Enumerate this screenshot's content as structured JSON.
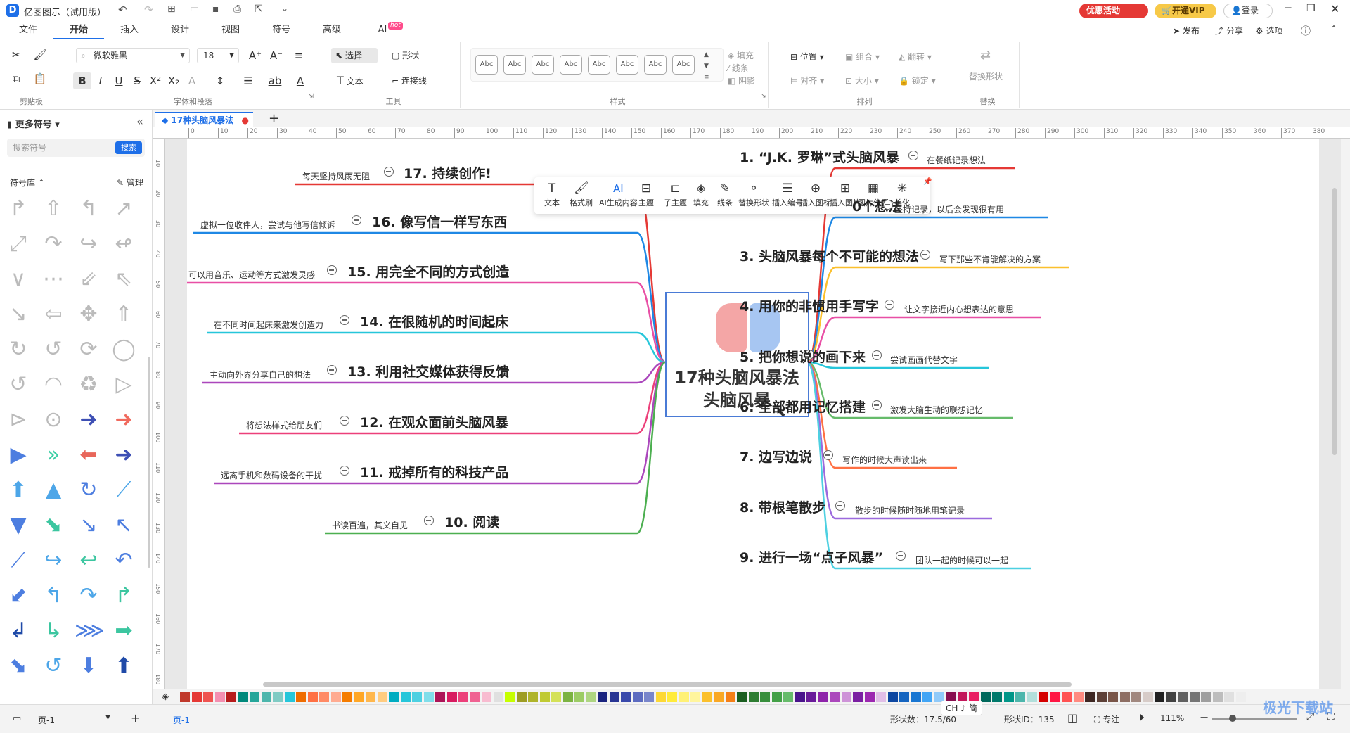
{
  "app": {
    "title": "亿图图示（试用版）"
  },
  "titlebar": {
    "promo": "优惠活动",
    "vip": "开通VIP",
    "login": "登录"
  },
  "menu": {
    "tabs": [
      "文件",
      "开始",
      "插入",
      "设计",
      "视图",
      "符号",
      "高级",
      "AI"
    ],
    "active": "开始",
    "ai_badge": "hot",
    "right": {
      "publish": "发布",
      "share": "分享",
      "options": "选项"
    }
  },
  "ribbon": {
    "font_name": "微软雅黑",
    "font_size": "18",
    "groups": {
      "clipboard": "剪贴板",
      "font": "字体和段落",
      "tools": "工具",
      "style": "样式",
      "arrange": "排列",
      "replace": "替换"
    },
    "tools": {
      "select": "选择",
      "shape": "形状",
      "text": "文本",
      "connector": "连接线"
    },
    "style_sample": "Abc",
    "style_count": 8,
    "fill": {
      "fill": "填充",
      "line": "线条",
      "shadow": "阴影"
    },
    "arrange": {
      "position": "位置",
      "group": "组合",
      "flip": "翻转",
      "align": "对齐",
      "size": "大小",
      "lock": "锁定"
    },
    "replace_shape": "替换形状"
  },
  "sidebar": {
    "title": "更多符号",
    "search_placeholder": "搜索符号",
    "search_btn": "搜索",
    "library": "符号库",
    "manage": "管理"
  },
  "doc_tab": {
    "name": "17种头脑风暴法"
  },
  "ruler": {
    "h_ticks": [
      "0",
      "10",
      "20",
      "30",
      "40",
      "50",
      "60",
      "70",
      "80",
      "90",
      "100",
      "110",
      "120",
      "130",
      "140",
      "150",
      "160",
      "170",
      "180",
      "190",
      "200",
      "210",
      "220",
      "230",
      "240",
      "250",
      "260",
      "270",
      "280",
      "290",
      "300",
      "310",
      "320",
      "330",
      "340",
      "350",
      "360",
      "370",
      "380"
    ],
    "v_ticks": [
      "10",
      "20",
      "30",
      "40",
      "50",
      "60",
      "70",
      "80",
      "90",
      "100",
      "110",
      "120",
      "130",
      "140",
      "150",
      "160",
      "170",
      "180"
    ]
  },
  "float_toolbar": [
    "文本",
    "格式刷",
    "AI生成内容",
    "主题",
    "子主题",
    "填充",
    "线条",
    "替换形状",
    "插入编号",
    "插入图标",
    "插入图片",
    "图片位置",
    "美化"
  ],
  "mindmap": {
    "center": {
      "line1": "17种头脑风暴法",
      "line2": "头脑风暴"
    },
    "right": [
      {
        "topic": "1. “J.K. 罗琳”式头脑风暴",
        "note": "在餐纸记录想法",
        "color": "#e53935"
      },
      {
        "topic": "0个想法",
        "note": "坚持记录，以后会发现很有用",
        "color": "#1e88e5"
      },
      {
        "topic": "3. 头脑风暴每个不可能的想法",
        "note": "写下那些不肯能解决的方案",
        "color": "#fbc02d"
      },
      {
        "topic": "4. 用你的非惯用手写字",
        "note": "让文字接近内心想表达的意思",
        "color": "#e84fa5"
      },
      {
        "topic": "5. 把你想说的画下来",
        "note": "尝试画画代替文字",
        "color": "#26c6da"
      },
      {
        "topic": "6. 全部都用记忆搭建",
        "note": "激发大脑生动的联想记忆",
        "color": "#66bb6a"
      },
      {
        "topic": "7. 边写边说",
        "note": "写作的时候大声读出来",
        "color": "#ff7043"
      },
      {
        "topic": "8. 带根笔散步",
        "note": "散步的时候随时随地用笔记录",
        "color": "#9c6ade"
      },
      {
        "topic": "9. 进行一场“点子风暴”",
        "note": "团队一起的时候可以一起",
        "color": "#4dd0e1"
      }
    ],
    "left": [
      {
        "topic": "17. 持续创作!",
        "note": "每天坚持风雨无阻",
        "color": "#e53935"
      },
      {
        "topic": "16. 像写信一样写东西",
        "note": "虚拟一位收件人，尝试与他写信倾诉",
        "color": "#1e88e5"
      },
      {
        "topic": "15. 用完全不同的方式创造",
        "note": "可以用音乐、运动等方式激发灵感",
        "color": "#e84fa5"
      },
      {
        "topic": "14. 在很随机的时间起床",
        "note": "在不同时间起床来激发创造力",
        "color": "#26c6da"
      },
      {
        "topic": "13. 利用社交媒体获得反馈",
        "note": "主动向外界分享自己的想法",
        "color": "#ab47bc"
      },
      {
        "topic": "12. 在观众面前头脑风暴",
        "note": "将想法样式给朋友们",
        "color": "#ec407a"
      },
      {
        "topic": "11. 戒掉所有的科技产品",
        "note": "远离手机和数码设备的干扰",
        "color": "#ab47bc"
      },
      {
        "topic": "10. 阅读",
        "note": "书读百遍，其义自见",
        "color": "#4caf50"
      }
    ]
  },
  "status": {
    "page": "页-1",
    "page_tab": "页-1",
    "shape_count": "形状数：17.5/60",
    "ime": "CH ♪ 简",
    "shape_id": "形状ID：135",
    "focus": "专注",
    "zoom": "111%"
  },
  "watermark": "极光下载站",
  "colors": {
    "accent": "#1e6fe8",
    "promo_red": "#e53935",
    "vip_gold": "#f7c948"
  }
}
